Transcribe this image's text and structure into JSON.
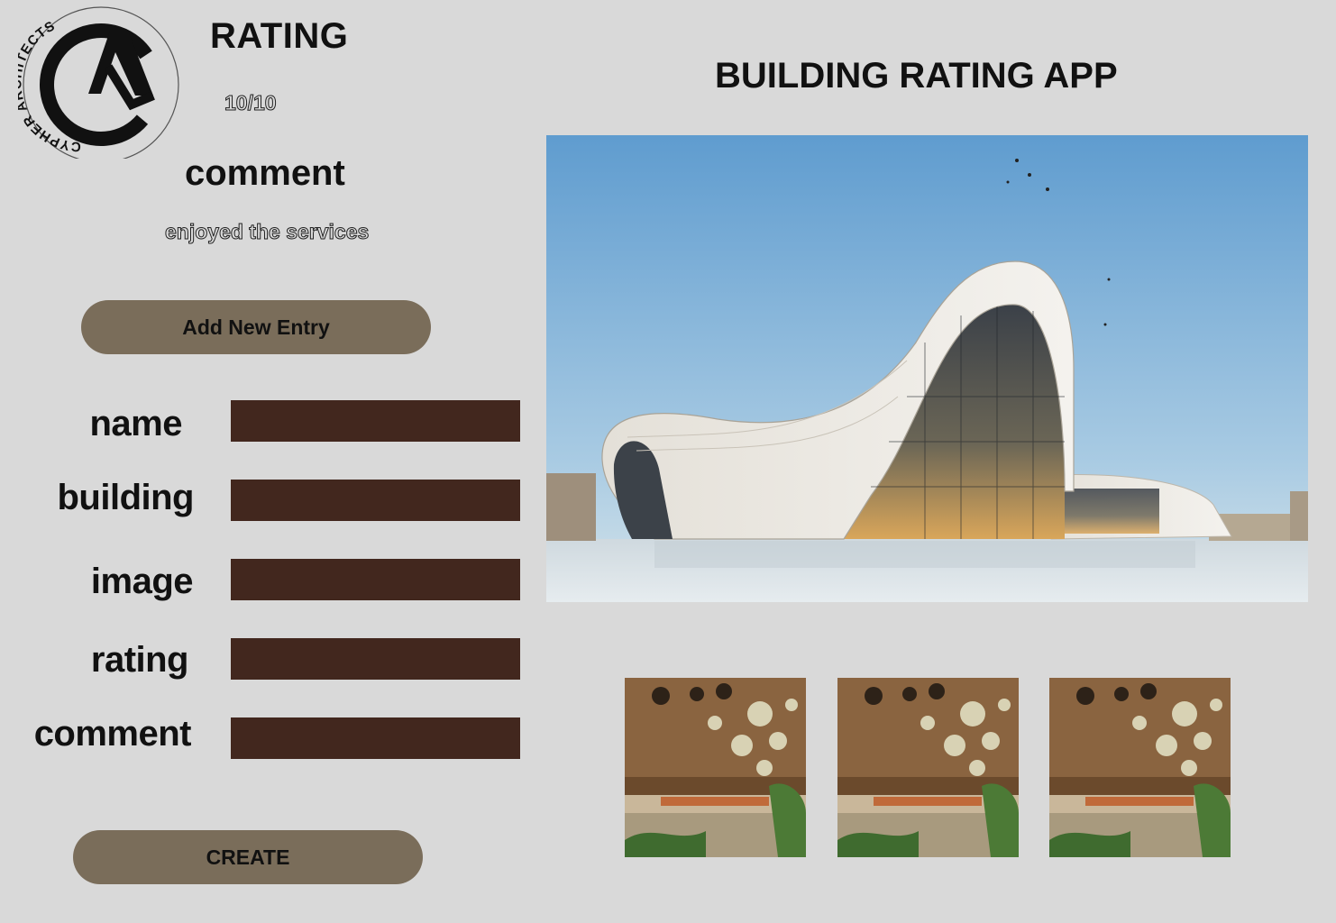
{
  "logo": {
    "brand_text": "CYPHER ARCHITECTS",
    "icon": "cypher-architects-logo"
  },
  "summary": {
    "rating_heading": "RATING",
    "rating_value": "10/10",
    "comment_heading": "comment",
    "comment_value": "enjoyed the services"
  },
  "actions": {
    "add_new_entry": "Add New Entry",
    "create": "CREATE"
  },
  "form": {
    "fields": [
      {
        "label": "name",
        "value": ""
      },
      {
        "label": "building",
        "value": ""
      },
      {
        "label": "image",
        "value": ""
      },
      {
        "label": "rating",
        "value": ""
      },
      {
        "label": "comment",
        "value": ""
      }
    ]
  },
  "header": {
    "app_title": "BUILDING RATING APP"
  },
  "gallery": {
    "hero_image": "curved-white-building-photo",
    "thumbnails": [
      "organic-interior-photo",
      "organic-interior-photo",
      "organic-interior-photo"
    ]
  },
  "colors": {
    "background": "#d9d9d9",
    "button": "#7a6d5a",
    "input": "#42271e"
  }
}
